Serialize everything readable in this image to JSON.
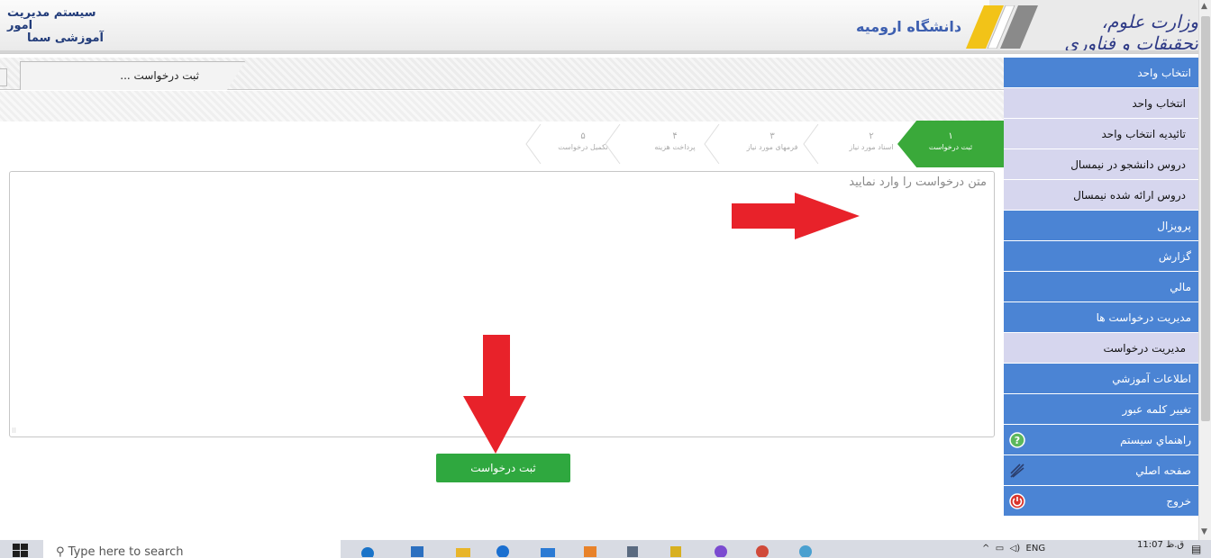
{
  "header": {
    "system_title_line1": "سیستم مدیریت امور",
    "system_title_line2": "آموزشی سما",
    "university": "دانشگاه ارومیه",
    "ministry": "وزارت علوم، تحقیقات و فناوری"
  },
  "tabs": {
    "active_label": "ثبت درخواست ..."
  },
  "wizard": {
    "steps": [
      {
        "num": "۱",
        "label": "ثبت درخواست",
        "active": true
      },
      {
        "num": "۲",
        "label": "اسناد مورد نیاز",
        "active": false
      },
      {
        "num": "۳",
        "label": "فرمهای مورد نیاز",
        "active": false
      },
      {
        "num": "۴",
        "label": "پرداخت هزینه",
        "active": false
      },
      {
        "num": "۵",
        "label": "تکمیل درخواست",
        "active": false
      }
    ]
  },
  "request": {
    "placeholder": "متن درخواست را وارد نمایید",
    "submit_label": "ثبت درخواست"
  },
  "sidebar": {
    "items": [
      {
        "label": "انتخاب واحد",
        "type": "category"
      },
      {
        "label": "انتخاب واحد",
        "type": "sub"
      },
      {
        "label": "تائیدیه انتخاب واحد",
        "type": "sub"
      },
      {
        "label": "دروس دانشجو در نیمسال",
        "type": "sub"
      },
      {
        "label": "دروس ارائه شده نیمسال",
        "type": "sub"
      },
      {
        "label": "پروپزال",
        "type": "category"
      },
      {
        "label": "گزارش",
        "type": "category"
      },
      {
        "label": "مالي",
        "type": "category"
      },
      {
        "label": "مديريت درخواست ها",
        "type": "category"
      },
      {
        "label": "مديريت درخواست",
        "type": "sub"
      },
      {
        "label": "اطلاعات آموزشي",
        "type": "category"
      },
      {
        "label": "تغيير كلمه عبور",
        "type": "category"
      },
      {
        "label": "راهنماي سيستم",
        "type": "category",
        "icon": "help-icon"
      },
      {
        "label": "صفحه اصلي",
        "type": "category",
        "icon": "home-icon"
      },
      {
        "label": "خروج",
        "type": "category",
        "icon": "power-icon"
      }
    ]
  },
  "taskbar": {
    "search_placeholder": "Type here to search",
    "lang": "ENG",
    "time": "11:07 ق.ظ"
  },
  "colors": {
    "sidebar_category": "#4b84d4",
    "sidebar_sub": "#d6d6ee",
    "step_active": "#3aa93a",
    "submit_button": "#2fa83f",
    "arrow_red": "#e8222a"
  }
}
